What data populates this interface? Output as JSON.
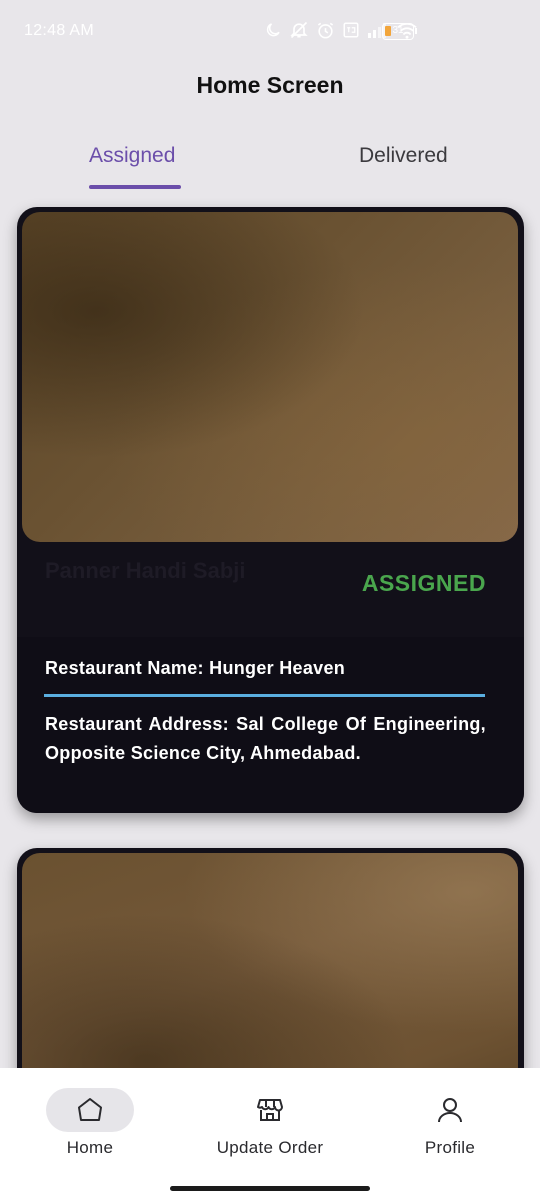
{
  "status_bar": {
    "time": "12:48 AM",
    "battery": "31",
    "icons": [
      "moon-icon",
      "mute-icon",
      "alarm-icon",
      "volte-icon",
      "signal-icon",
      "wifi-icon",
      "battery-icon"
    ]
  },
  "header": {
    "title": "Home Screen"
  },
  "tabs": [
    {
      "label": "Assigned",
      "selected": true
    },
    {
      "label": "Delivered",
      "selected": false
    }
  ],
  "orders": [
    {
      "dish_name": "Panner Handi Sabji",
      "status": "ASSIGNED",
      "restaurant_name": "Restaurant Name: Hunger Heaven",
      "restaurant_address": "Restaurant Address: Sal College Of Engineering, Opposite Science City, Ahmedabad."
    },
    {
      "dish_name": "",
      "status": "",
      "restaurant_name": "",
      "restaurant_address": ""
    }
  ],
  "bottom_nav": [
    {
      "label": "Home",
      "icon": "home-icon",
      "selected": true
    },
    {
      "label": "Update Order",
      "icon": "store-icon",
      "selected": false
    },
    {
      "label": "Profile",
      "icon": "person-icon",
      "selected": false
    }
  ],
  "colors": {
    "accent": "#6b4eaa",
    "status_assigned": "#4aa64d",
    "divider": "#5aaee0",
    "card_bg": "#121019",
    "page_bg": "#e8e6ea"
  }
}
